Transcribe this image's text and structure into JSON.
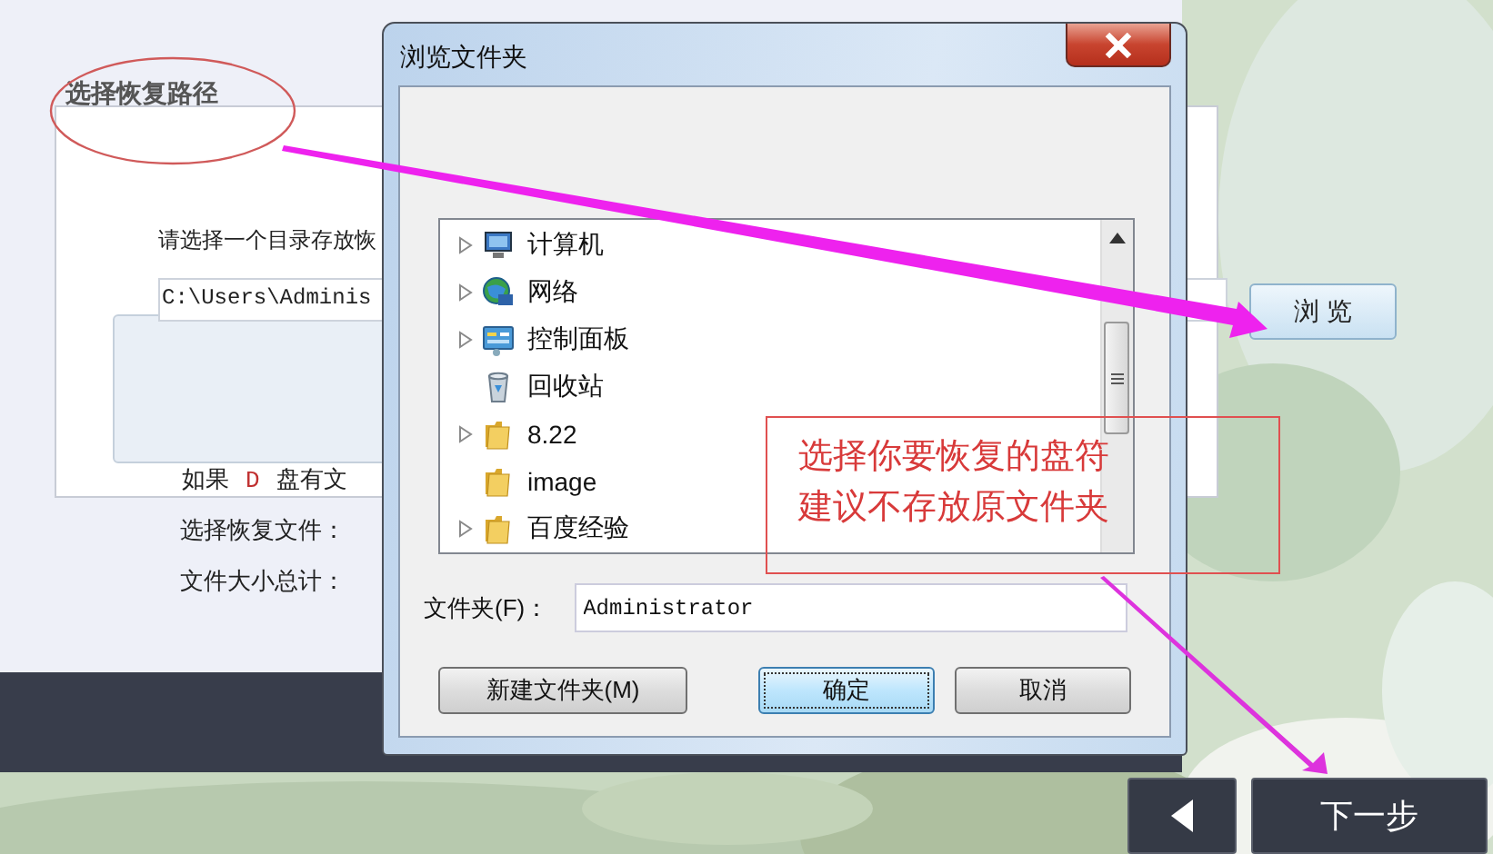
{
  "app": {
    "section_title": "选择恢复路径",
    "instruction": "请选择一个目录存放恢",
    "path_value": "C:\\Users\\Adminis",
    "browse_button": "浏 览",
    "info_lines": [
      {
        "kind": "drive",
        "prefix": "如果",
        "drive": "D",
        "suffix": "盘有文"
      },
      {
        "kind": "plain",
        "text": "选择恢复文件："
      },
      {
        "kind": "plain",
        "text": "文件大小总计："
      }
    ],
    "next_button": "下一步"
  },
  "dialog": {
    "title": "浏览文件夹",
    "tree": [
      {
        "label": "计算机",
        "kind": "computer",
        "has_children": true
      },
      {
        "label": "网络",
        "kind": "network",
        "has_children": true
      },
      {
        "label": "控制面板",
        "kind": "control-panel",
        "has_children": true
      },
      {
        "label": "回收站",
        "kind": "recycle-bin",
        "has_children": false
      },
      {
        "label": "8.22",
        "kind": "folder",
        "has_children": true
      },
      {
        "label": "image",
        "kind": "folder",
        "has_children": false
      },
      {
        "label": "百度经验",
        "kind": "folder",
        "has_children": true
      }
    ],
    "folder_label": "文件夹(F)：",
    "folder_value": "Administrator",
    "buttons": [
      {
        "label": "新建文件夹(M)",
        "default": false
      },
      {
        "label": "确定",
        "default": true
      },
      {
        "label": "取消",
        "default": false
      }
    ]
  },
  "annotation": {
    "note_lines": [
      "选择你要恢复的盘符",
      "建议不存放原文件夹"
    ]
  }
}
